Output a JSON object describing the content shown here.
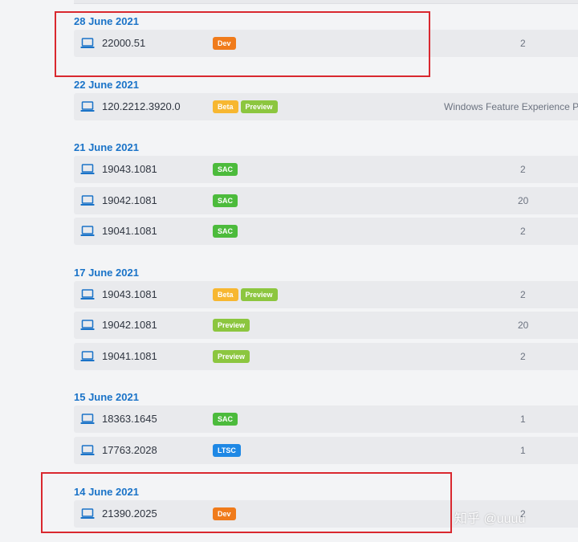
{
  "colors": {
    "accent_date": "#1a73c8",
    "highlight_border": "#d9282f",
    "badge_dev": "#f07b1b",
    "badge_beta": "#f7b731",
    "badge_preview": "#8cc63f",
    "badge_sac": "#4cbb3c",
    "badge_ltsc": "#1e88e5"
  },
  "icon": "laptop-icon",
  "groups": [
    {
      "date": "28 June 2021",
      "highlighted": true,
      "rows": [
        {
          "version": "22000.51",
          "badges": [
            "Dev"
          ],
          "right": "2"
        }
      ]
    },
    {
      "date": "22 June 2021",
      "rows": [
        {
          "version": "120.2212.3920.0",
          "badges": [
            "Beta",
            "Preview"
          ],
          "right": "Windows Feature Experience P"
        }
      ]
    },
    {
      "date": "21 June 2021",
      "rows": [
        {
          "version": "19043.1081",
          "badges": [
            "SAC"
          ],
          "right": "2"
        },
        {
          "version": "19042.1081",
          "badges": [
            "SAC"
          ],
          "right": "20"
        },
        {
          "version": "19041.1081",
          "badges": [
            "SAC"
          ],
          "right": "2"
        }
      ]
    },
    {
      "date": "17 June 2021",
      "rows": [
        {
          "version": "19043.1081",
          "badges": [
            "Beta",
            "Preview"
          ],
          "right": "2"
        },
        {
          "version": "19042.1081",
          "badges": [
            "Preview"
          ],
          "right": "20"
        },
        {
          "version": "19041.1081",
          "badges": [
            "Preview"
          ],
          "right": "2"
        }
      ]
    },
    {
      "date": "15 June 2021",
      "rows": [
        {
          "version": "18363.1645",
          "badges": [
            "SAC"
          ],
          "right": "1"
        },
        {
          "version": "17763.2028",
          "badges": [
            "LTSC"
          ],
          "right": "1"
        }
      ]
    },
    {
      "date": "14 June 2021",
      "highlighted": true,
      "rows": [
        {
          "version": "21390.2025",
          "badges": [
            "Dev"
          ],
          "right": "2"
        }
      ]
    }
  ],
  "watermark": "知乎 @uuuu"
}
